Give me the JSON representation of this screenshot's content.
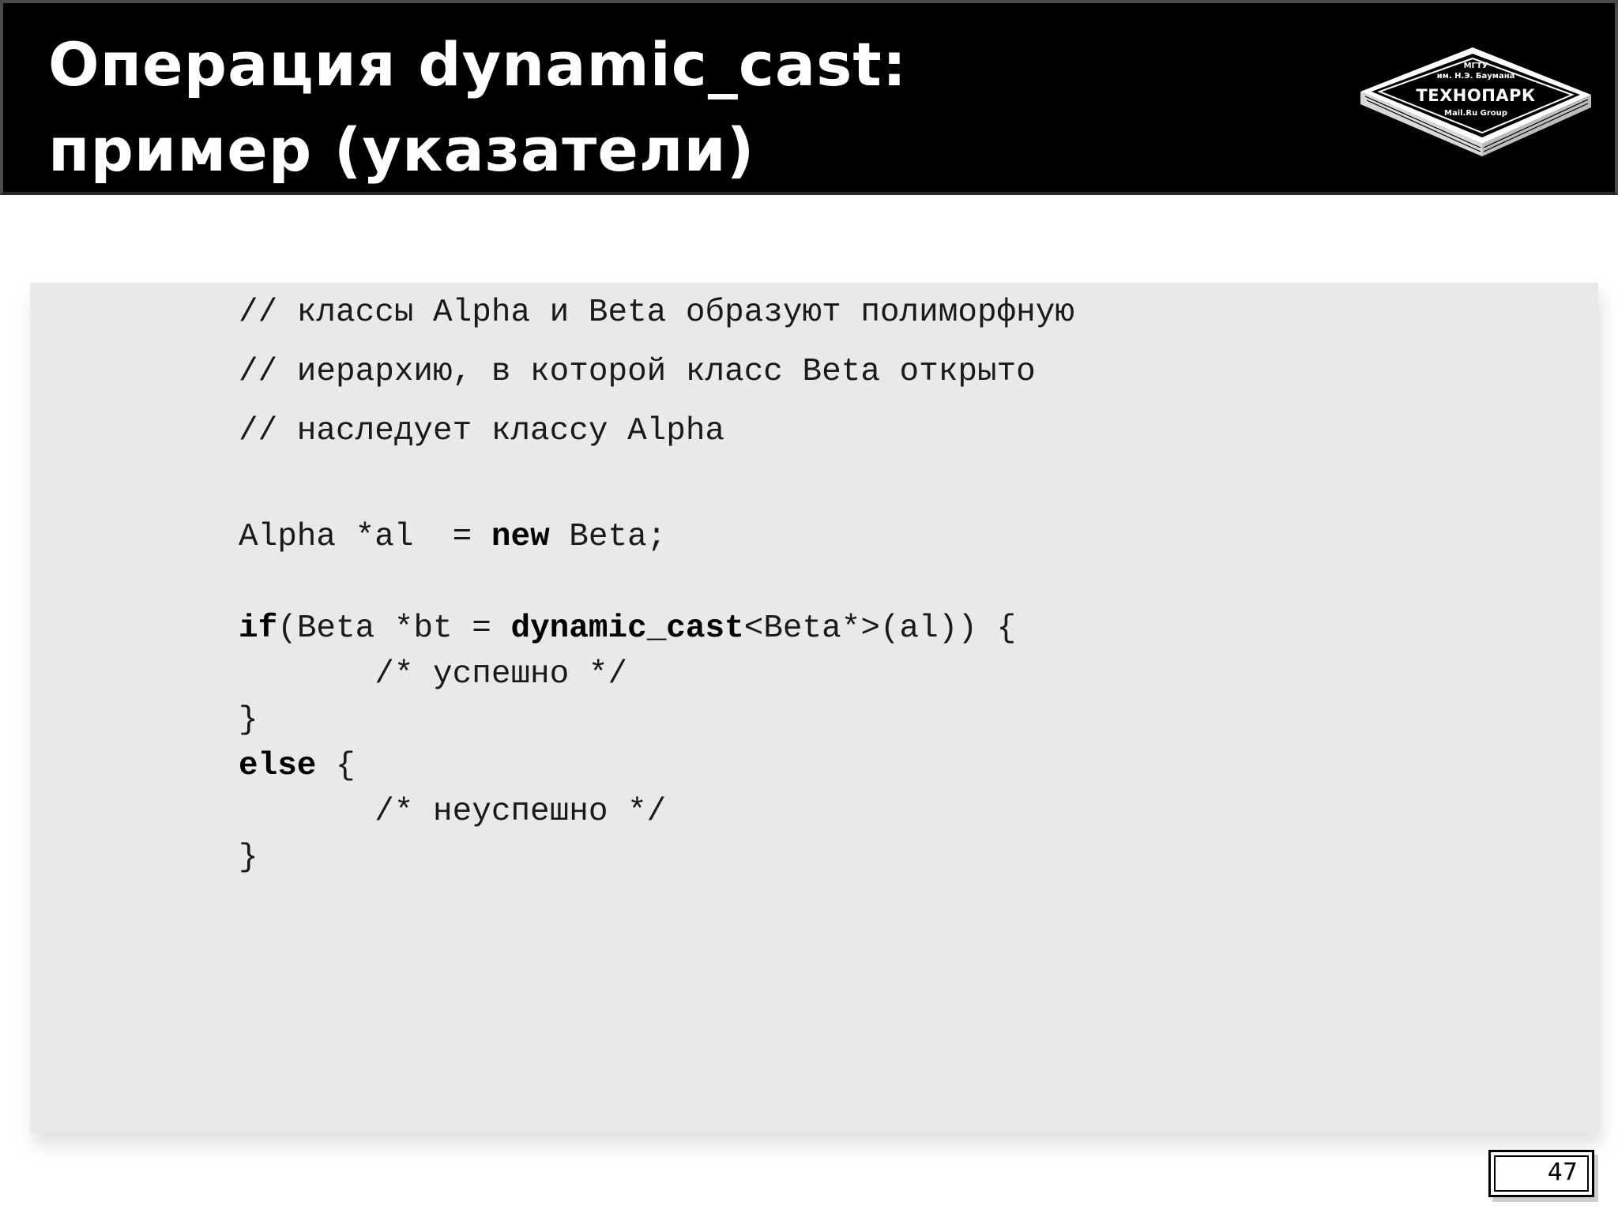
{
  "slide": {
    "title_line1": "Операция dynamic_cast:",
    "title_line2": "пример (указатели)",
    "page_number": "47"
  },
  "logo": {
    "line1": "МГТУ",
    "line2": "им. Н.Э. Баумана",
    "brand": "ТЕХНОПАРК",
    "sub": "Mail.Ru Group"
  },
  "code": {
    "comment1": "// классы Alpha и Beta образуют полиморфную",
    "comment2": "// иерархию, в которой класс Beta открыто",
    "comment3": "// наследует классу Alpha",
    "decl_pre": "Alpha *al  = ",
    "decl_kw": "new",
    "decl_post": " Beta;",
    "if_kw": "if",
    "if_mid": "(Beta *bt = ",
    "cast_kw": "dynamic_cast",
    "if_post": "<Beta*>(al)) {",
    "success_comment": "       /* успешно */",
    "close_brace1": "}",
    "else_kw": "else",
    "else_post": " {",
    "fail_comment": "       /* неуспешно */",
    "close_brace2": "}"
  }
}
